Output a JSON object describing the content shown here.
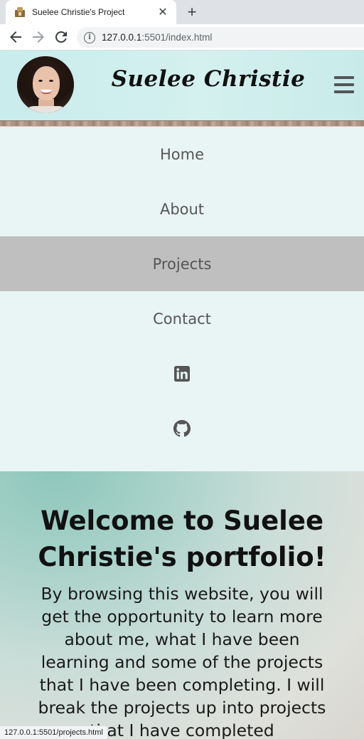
{
  "browser": {
    "tab_title": "Suelee Christie's Project",
    "close_glyph": "✕",
    "newtab_glyph": "+",
    "url_host": "127.0.0.1",
    "url_path": ":5501/index.html",
    "info_glyph": "i",
    "status_url": "127.0.0.1:5501/projects.html"
  },
  "header": {
    "brand": "Suelee Christie"
  },
  "nav": {
    "items": [
      {
        "label": "Home",
        "active": false
      },
      {
        "label": "About",
        "active": false
      },
      {
        "label": "Projects",
        "active": true
      },
      {
        "label": "Contact",
        "active": false
      }
    ],
    "icons": [
      "linkedin-icon",
      "github-icon"
    ]
  },
  "hero": {
    "title": "Welcome to Suelee Christie's portfolio!",
    "text": "By browsing this website, you will get the opportunity to learn more about me, what I have been learning and some of the projects that I have been completing. I will break the projects up into projects that I have completed"
  },
  "colors": {
    "nav_bg": "#e9f5f4",
    "nav_active": "#bfbfbf",
    "header_bg": "#d4f0ef"
  }
}
